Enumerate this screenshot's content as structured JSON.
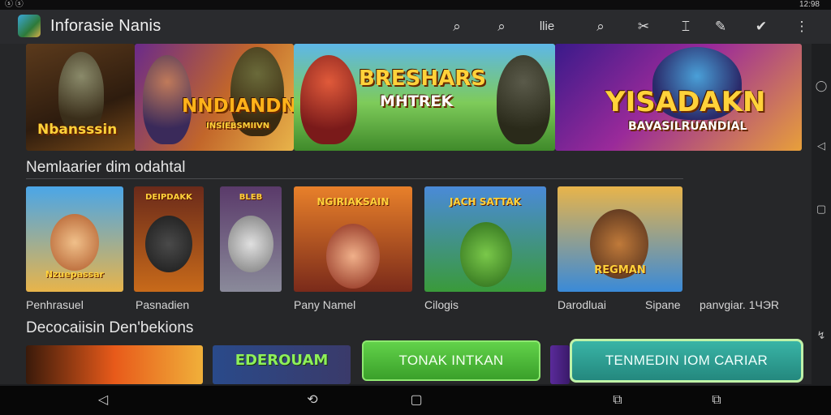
{
  "status_bar": {
    "left": "ⓢ ⓢ",
    "right": "12:98"
  },
  "app": {
    "title": "Inforasie Nanis"
  },
  "toolbar_icons": [
    {
      "name": "search-icon",
      "glyph": "⌕"
    },
    {
      "name": "search-icon-2",
      "glyph": "⌕"
    },
    {
      "name": "quick-action-label",
      "glyph": "Ɩlie"
    },
    {
      "name": "search-icon-3",
      "glyph": "⌕"
    },
    {
      "name": "tools-icon",
      "glyph": "✂"
    },
    {
      "name": "pin-icon",
      "glyph": "⌶"
    },
    {
      "name": "edit-icon",
      "glyph": "✎"
    },
    {
      "name": "shield-icon",
      "glyph": "✔"
    },
    {
      "name": "more-icon",
      "glyph": "⋮"
    }
  ],
  "banners": [
    {
      "title": "Nbansssin",
      "accent": "#ffd23a"
    },
    {
      "title": "NNDIANDN",
      "subtitle": "INSIEBSMIIVN",
      "accent": "#ffb21a"
    },
    {
      "title": "BRESHARS",
      "subtitle": "MHTREK",
      "accent": "#ffd23a"
    },
    {
      "title": "YISADAKN",
      "subtitle": "BAVASILRUANDIAL",
      "accent": "#ffd23a"
    }
  ],
  "section1": {
    "title": "Nemlaarier dim odahtal"
  },
  "cards": [
    {
      "art_title": "Nzuepassar",
      "caption": "Penhrasuel"
    },
    {
      "art_title": "DEIPDAKK",
      "caption": "Pasnadien"
    },
    {
      "art_title": "BLEB",
      "caption": "Pany Namel"
    },
    {
      "art_title": "NGIRIAKSAIN",
      "caption": ""
    },
    {
      "art_title": "JACH SATTAK",
      "caption": "Cilogis"
    },
    {
      "art_title": "REGMAN",
      "caption": "Darodluai"
    }
  ],
  "extra_captions": [
    {
      "text": "Sipane"
    },
    {
      "text": "panvgiar. 1ЧЭR"
    }
  ],
  "section2": {
    "title": "Decocaiisin Den'bekions"
  },
  "row2": [
    {
      "art_title": ""
    },
    {
      "art_title": "EDEROUAM"
    }
  ],
  "buttons": {
    "primary": "TONAK INTKAN",
    "secondary": "TENMEDIN IOM CARIAR"
  },
  "side_icons": [
    "◯",
    "◁",
    "▢",
    "↯"
  ],
  "nav_icons": [
    {
      "name": "back-icon",
      "glyph": "◁"
    },
    {
      "name": "rotate-icon",
      "glyph": "⟲"
    },
    {
      "name": "home-icon",
      "glyph": "▢"
    },
    {
      "name": "recents-icon",
      "glyph": "⧉"
    },
    {
      "name": "recents-icon-2",
      "glyph": "⧉"
    }
  ],
  "colors": {
    "accent_gold": "#ffd23a",
    "green_button": "#4dbb36",
    "teal_button": "#2fa496",
    "background": "#262729"
  }
}
